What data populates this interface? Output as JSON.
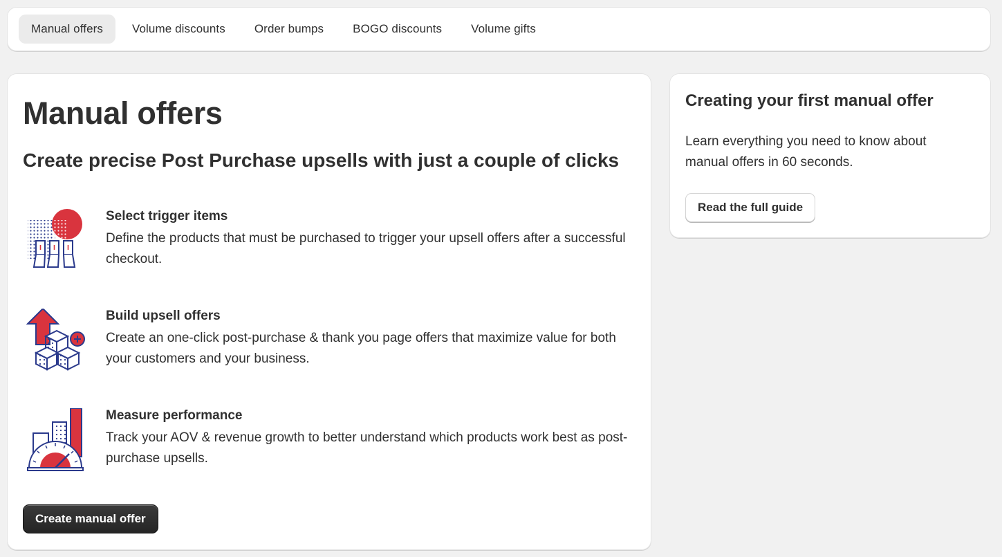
{
  "tabs": [
    {
      "label": "Manual offers",
      "active": true
    },
    {
      "label": "Volume discounts",
      "active": false
    },
    {
      "label": "Order bumps",
      "active": false
    },
    {
      "label": "BOGO discounts",
      "active": false
    },
    {
      "label": "Volume gifts",
      "active": false
    }
  ],
  "main": {
    "title": "Manual offers",
    "subtitle": "Create precise Post Purchase upsells with just a couple of clicks",
    "features": [
      {
        "icon": "trigger-items-icon",
        "title": "Select trigger items",
        "description": "Define the products that must be purchased to trigger your upsell offers after a successful checkout."
      },
      {
        "icon": "upsell-offers-icon",
        "title": "Build upsell offers",
        "description": "Create an one-click post-purchase & thank you page offers that maximize value for both your customers and your business."
      },
      {
        "icon": "performance-gauge-icon",
        "title": "Measure performance",
        "description": "Track your AOV & revenue growth to better understand which products work best as post-purchase upsells."
      }
    ],
    "create_button": "Create manual offer"
  },
  "guide": {
    "title": "Creating your first manual offer",
    "description": "Learn everything you need to know about manual offers in 60 seconds.",
    "button": "Read the full guide"
  },
  "colors": {
    "background": "#f1f1f1",
    "accent_red": "#d9343e",
    "accent_navy": "#2b3a8c",
    "primary_button": "#303030"
  }
}
